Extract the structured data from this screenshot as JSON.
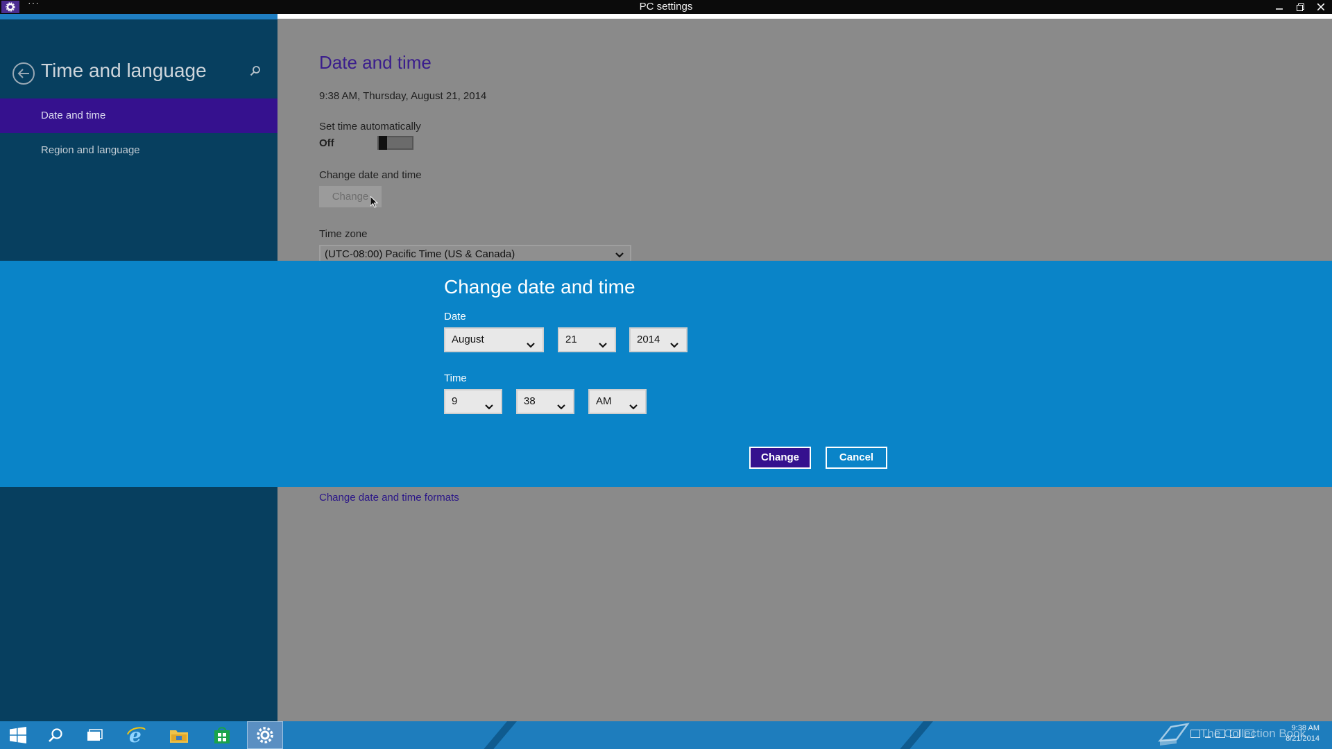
{
  "window": {
    "title": "PC settings",
    "menu_dots": "···"
  },
  "sidebar": {
    "title": "Time and language",
    "items": [
      {
        "label": "Date and time",
        "active": true
      },
      {
        "label": "Region and language",
        "active": false
      }
    ]
  },
  "main": {
    "page_title": "Date and time",
    "current_datetime": "9:38 AM, Thursday, August 21, 2014",
    "set_time_auto_label": "Set time automatically",
    "set_time_auto_state": "Off",
    "change_section_label": "Change date and time",
    "change_button_label": "Change",
    "timezone_label": "Time zone",
    "timezone_value": "(UTC-08:00) Pacific Time (US & Canada)",
    "formats_link": "Change date and time formats"
  },
  "dialog": {
    "title": "Change date and time",
    "date_label": "Date",
    "month": "August",
    "day": "21",
    "year": "2014",
    "time_label": "Time",
    "hour": "9",
    "minute": "38",
    "ampm": "AM",
    "change_button": "Change",
    "cancel_button": "Cancel"
  },
  "taskbar": {
    "watermark": "The Collection Book",
    "clock_time": "9:38 AM",
    "clock_date": "8/21/2014"
  },
  "colors": {
    "sidebar_bg": "#073f5f",
    "nav_active": "#35118e",
    "dialog_bg": "#0a84c8",
    "content_bg": "#8a8a8a",
    "taskbar_bg": "#1e7dbd"
  }
}
